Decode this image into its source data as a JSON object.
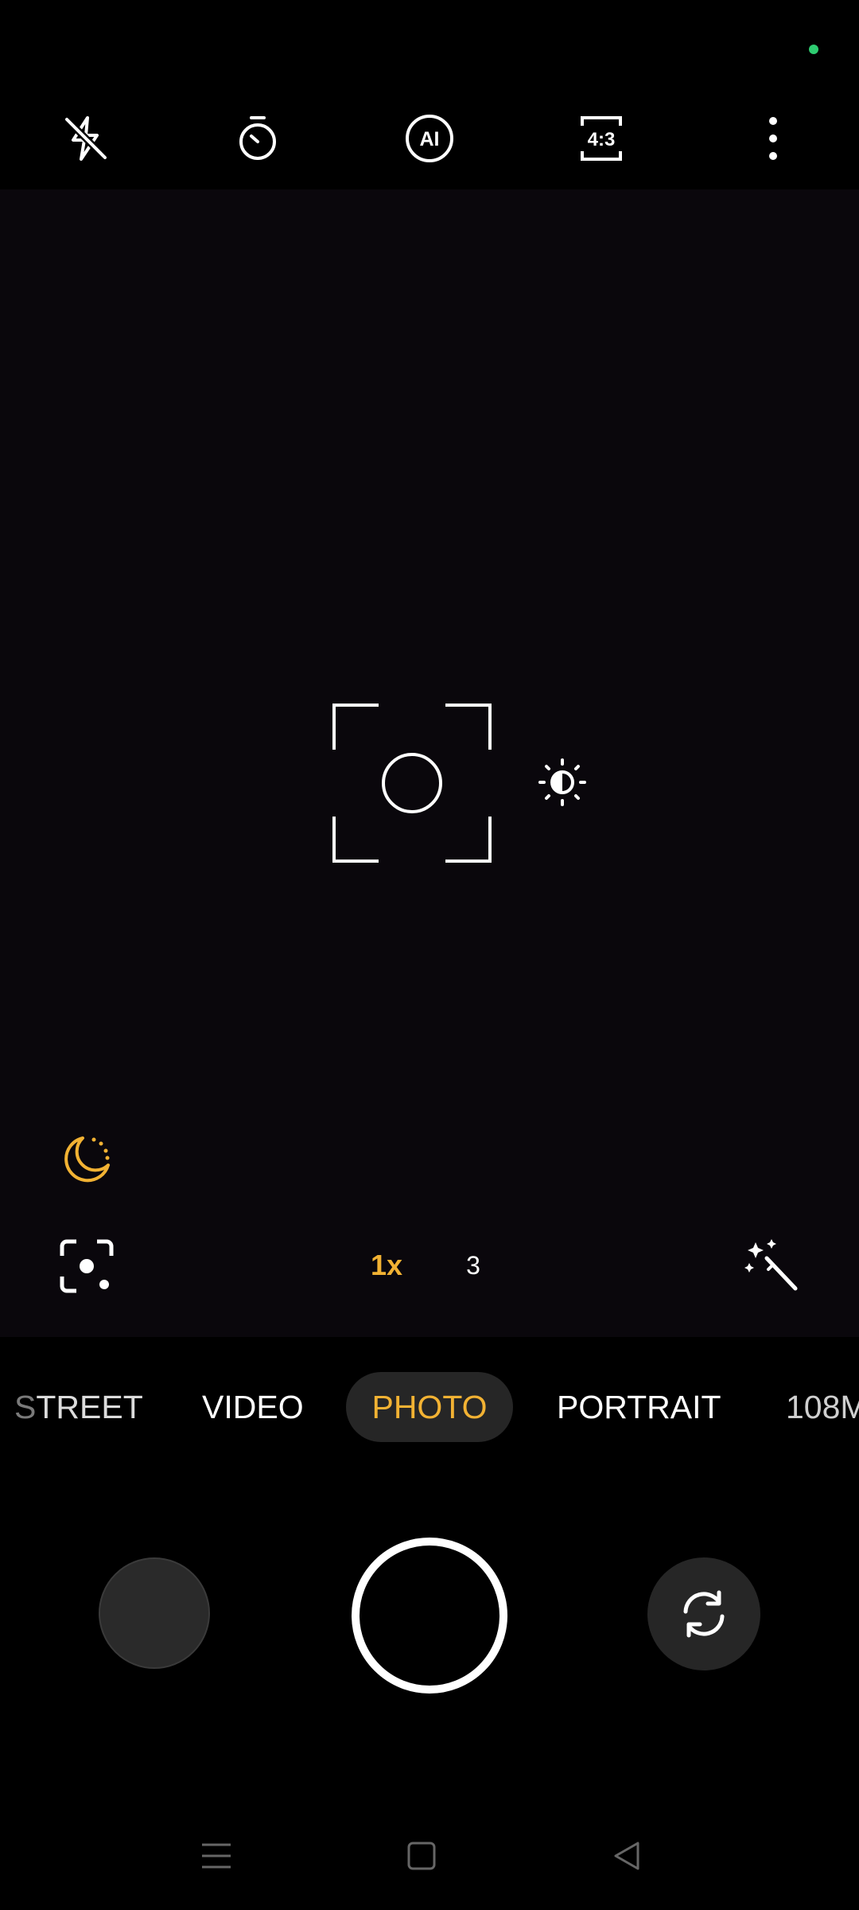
{
  "status_bar": {
    "privacy_indicator": "green-dot",
    "indicator_color": "#2ecc71"
  },
  "top_bar": {
    "icons": [
      "flash-off-icon",
      "timer-icon",
      "ai-icon",
      "aspect-ratio-icon",
      "more-options-icon"
    ],
    "ai_label": "AI",
    "aspect_ratio_label": "4:3"
  },
  "viewfinder": {
    "icons": [
      "focus-frame-icon",
      "exposure-icon",
      "night-mode-icon",
      "lens-icon",
      "magic-wand-icon"
    ]
  },
  "zoom": {
    "active": "1x",
    "other": "3"
  },
  "modes": {
    "street_main": "TREET",
    "street_prefix": "S",
    "video": "VIDEO",
    "photo": "PHOTO",
    "portrait": "PORTRAIT",
    "mp108": "108M",
    "selected": "PHOTO"
  },
  "controls": {
    "icons": [
      "gallery-thumbnail",
      "shutter-button",
      "flip-camera-icon"
    ]
  },
  "nav": {
    "icons": [
      "menu-icon",
      "home-icon",
      "back-icon"
    ]
  },
  "colors": {
    "accent": "#f2b233",
    "background": "#000000",
    "viewfinder": "#0a070c"
  }
}
